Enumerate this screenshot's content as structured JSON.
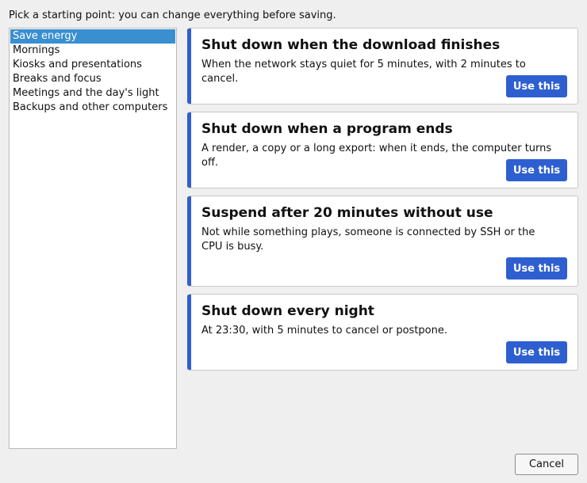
{
  "intro": "Pick a starting point: you can change everything before saving.",
  "categories": [
    {
      "label": "Save energy",
      "selected": true
    },
    {
      "label": "Mornings",
      "selected": false
    },
    {
      "label": "Kiosks and presentations",
      "selected": false
    },
    {
      "label": "Breaks and focus",
      "selected": false
    },
    {
      "label": "Meetings and the day's light",
      "selected": false
    },
    {
      "label": "Backups and other computers",
      "selected": false
    }
  ],
  "templates": [
    {
      "title": "Shut down when the download finishes",
      "description": "When the network stays quiet for 5 minutes, with 2 minutes to cancel.",
      "button": "Use this"
    },
    {
      "title": "Shut down when a program ends",
      "description": "A render, a copy or a long export: when it ends, the computer turns off.",
      "button": "Use this"
    },
    {
      "title": "Suspend after 20 minutes without use",
      "description": "Not while something plays, someone is connected by SSH or the CPU is busy.",
      "button": "Use this"
    },
    {
      "title": "Shut down every night",
      "description": "At 23:30, with 5 minutes to cancel or postpone.",
      "button": "Use this"
    }
  ],
  "footer": {
    "cancel_label": "Cancel"
  },
  "colors": {
    "accent": "#2e5fd0",
    "selection": "#3a8fd1"
  }
}
